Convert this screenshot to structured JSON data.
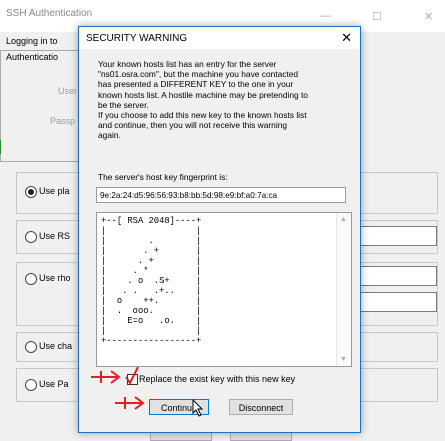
{
  "background": {
    "title": "SSH Authentication",
    "logging_in": "Logging in to",
    "auth_label": "Authenticatio",
    "user_label": "User",
    "pass_label": "Passp",
    "options": [
      {
        "label": "Use pla",
        "checked": true
      },
      {
        "label": "Use RS",
        "checked": false
      },
      {
        "label": "Use rho",
        "checked": false
      },
      {
        "label": "Use cha",
        "checked": false
      },
      {
        "label": "Use Pa",
        "checked": false
      }
    ],
    "controls": {
      "minimize": "—",
      "maximize": "☐",
      "close": "✕"
    }
  },
  "dialog": {
    "title": "SECURITY WARNING",
    "close": "✕",
    "message_lines": [
      "Your known hosts list has an entry for the server",
      "\"ns01.osra.com\", but the machine you have contacted",
      "has presented a DIFFERENT KEY to the one in your",
      "known hosts list. A hostile machine may be pretending to",
      "be the server.",
      "If you choose to add this new key to the known hosts list",
      "and continue, then you will not receive this warning",
      "again."
    ],
    "fingerprint_label": "The server's host key fingerprint is:",
    "fingerprint": "9e:2a:24:d5:96:56:93:b8:bb:5d:98:e9:bf:a0:7a:ca",
    "randomart": "+--[ RSA 2048]----+\n|                 |\n|        .        |\n|       . +       |\n|      . +        |\n|     . *         |\n|    . o  .S+     |\n|   . .   .+..    |\n|  o    ++.       |\n|  .  ooo.        |\n|    E=o   .o.    |\n|                 |\n+-----------------+",
    "checkbox_label": "Replace the exist key with this new key",
    "checkbox_checked": false,
    "continue_label": "Continue",
    "disconnect_label": "Disconnect"
  },
  "colors": {
    "annotation": "#e02020",
    "accent": "#0078d7"
  }
}
